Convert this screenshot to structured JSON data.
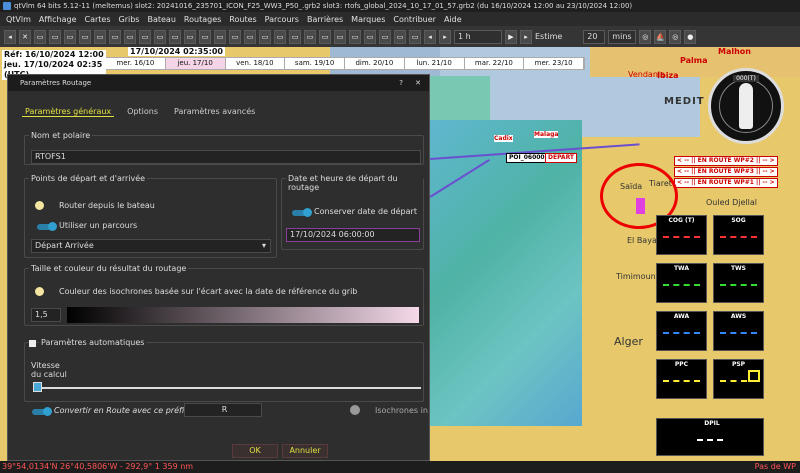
{
  "window": {
    "title": "qtVlm 64 bits 5.12-11 (meltemus) slot2: 20241016_235701_ICON_F25_WW3_P50_.grb2 slot3: rtofs_global_2024_10_17_01_57.grb2 (du 16/10/2024 12:00 au 23/10/2024 12:00)"
  },
  "menu": [
    "QtVlm",
    "Affichage",
    "Cartes",
    "Gribs",
    "Bateau",
    "Routages",
    "Routes",
    "Parcours",
    "Barrières",
    "Marques",
    "Contribuer",
    "Aide"
  ],
  "toolbar": {
    "step": "1 h",
    "estime": "Estime",
    "minutes_value": "20",
    "minutes_unit": "mins"
  },
  "map": {
    "ref_date": "Réf: 16/10/2024 12:00",
    "cur_date": "jeu. 17/10/2024 02:35",
    "utc": "(UTC)",
    "cursor_date": "17/10/2024 02:35:00",
    "timeline": [
      "mer. 16/10",
      "jeu. 17/10",
      "ven. 18/10",
      "sam. 19/10",
      "dim. 20/10",
      "lun. 21/10",
      "mar. 22/10",
      "mer. 23/10"
    ],
    "labels": {
      "malhon": "Malhon",
      "palma": "Palma",
      "vendania": "Vendania",
      "ibiza": "Ibiza",
      "medit": "MEDIT",
      "cadiz": "Cadix",
      "malaga": "Malaga",
      "tiaret": "Tiaret",
      "saida": "Saïda",
      "el_bayadh": "El Bayadh",
      "ouled_djellal": "Ouled Djellal",
      "timimoun": "Timimoun",
      "alger": "Alger",
      "start_label": "POI_060001",
      "depart": "DÉPART"
    },
    "waypoints": [
      "< -- || EN ROUTE WP#2 || -- >",
      "< -- || EN ROUTE WP#3 || -- >",
      "< -- || EN ROUTE WP#1 || -- >"
    ],
    "instruments": [
      {
        "name": "COG (T)",
        "color": "#ff3333"
      },
      {
        "name": "SOG",
        "color": "#ff3333"
      },
      {
        "name": "TWA",
        "color": "#33dd33"
      },
      {
        "name": "TWS",
        "color": "#33dd33"
      },
      {
        "name": "AWA",
        "color": "#3388ff"
      },
      {
        "name": "AWS",
        "color": "#3388ff"
      },
      {
        "name": "PPC",
        "color": "#ffee33"
      },
      {
        "name": "PSP",
        "color": "#ffee33"
      },
      {
        "name": "DPIL",
        "color": "#ffffff"
      }
    ],
    "compass_heading": "000(T)"
  },
  "dialog": {
    "title": "Paramètres Routage",
    "tabs": [
      "Paramètres généraux",
      "Options",
      "Paramètres avancés"
    ],
    "name_group": "Nom et polaire",
    "name_value": "RTOFS1",
    "points_group": "Points de départ et d'arrivée",
    "router_from_boat": "Router depuis le bateau",
    "use_route": "Utiliser un parcours",
    "route_select": "Départ Arrivée",
    "date_group": "Date et heure de départ du routage",
    "keep_date": "Conserver date de départ",
    "date_value": "17/10/2024 06:00:00",
    "size_group": "Taille et couleur du résultat du routage",
    "isochrone_color": "Couleur des isochrones basée sur l'écart avec la date de référence du grib",
    "line_width": "1,5",
    "auto_group": "Paramètres automatiques",
    "speed_label": "Vitesse du calcul",
    "convert_route": "Convertir en Route avec ce préfixe",
    "prefix": "R",
    "isochrones": "Isochrones in",
    "ok": "OK",
    "cancel": "Annuler"
  },
  "status": {
    "coords": "39°54,0134'N 26°40,5806'W - 292,9° 1 359 nm",
    "right": "Pas de WP"
  }
}
